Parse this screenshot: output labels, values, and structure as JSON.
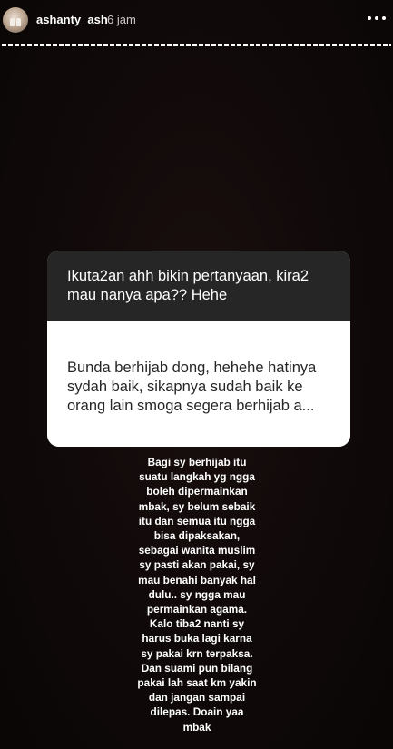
{
  "header": {
    "username": "ashanty_ash",
    "time": "6 jam",
    "avatar_icon": "avatar-photo",
    "more_icon": "more-dots-icon"
  },
  "question_card": {
    "question": "Ikuta2an ahh bikin pertanyaan, kira2 mau nanya apa?? Hehe",
    "answer": "Bunda berhijab dong, hehehe hatinya sydah baik, sikapnya sudah baik ke orang lain smoga segera berhijab a..."
  },
  "reply": {
    "lines": [
      "Bagi sy berhijab itu",
      "suatu langkah yg ngga",
      "boleh dipermainkan",
      "mbak, sy belum sebaik",
      "itu dan semua itu ngga",
      "bisa dipaksakan,",
      "sebagai wanita muslim",
      "sy pasti akan pakai, sy",
      "mau benahi banyak hal",
      "dulu.. sy ngga mau",
      "permainkan agama.",
      "Kalo tiba2 nanti sy",
      "harus buka lagi karna",
      "sy pakai krn terpaksa.",
      "Dan suami pun bilang",
      "pakai lah saat km yakin",
      "dan jangan sampai",
      "dilepas. Doain yaa",
      "mbak"
    ]
  },
  "colors": {
    "background": "#0b0707",
    "card_question_bg": "#262626",
    "card_answer_bg": "#ffffff",
    "text_light": "#ffffff"
  }
}
